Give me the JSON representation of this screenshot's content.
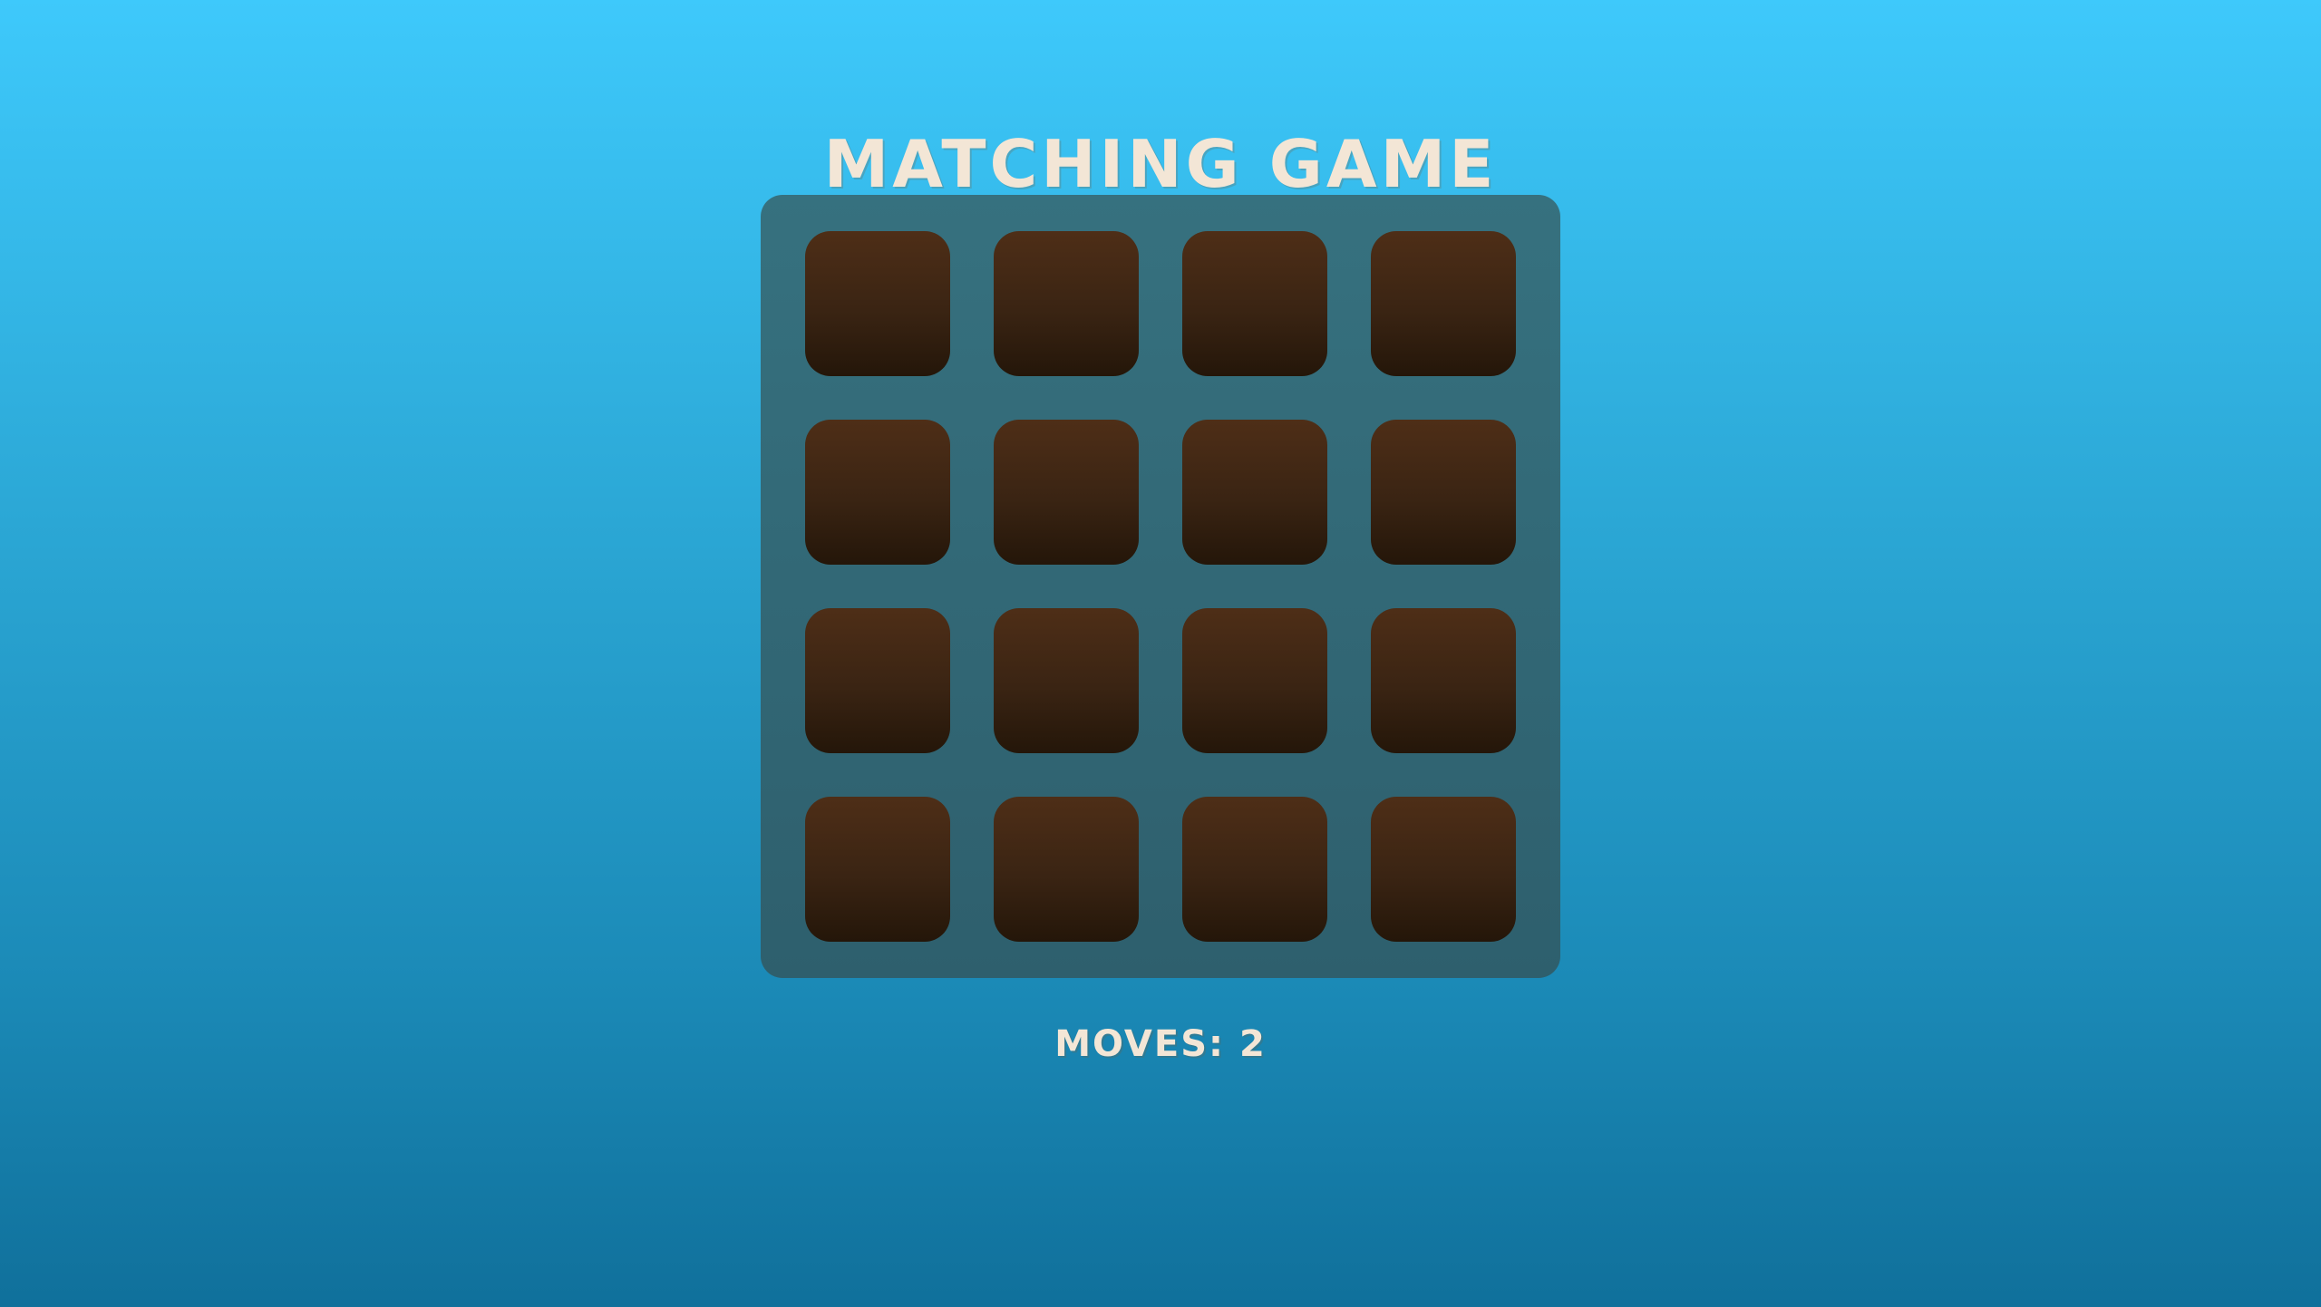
{
  "game": {
    "title": "MATCHING GAME",
    "moves_label": "MOVES:",
    "moves_value": "2",
    "grid": {
      "rows": 4,
      "columns": 4
    },
    "cards": [
      {
        "state": "face-down"
      },
      {
        "state": "face-down"
      },
      {
        "state": "face-down"
      },
      {
        "state": "face-down"
      },
      {
        "state": "face-down"
      },
      {
        "state": "face-down"
      },
      {
        "state": "face-down"
      },
      {
        "state": "face-down"
      },
      {
        "state": "face-down"
      },
      {
        "state": "face-down"
      },
      {
        "state": "face-down"
      },
      {
        "state": "face-down"
      },
      {
        "state": "face-down"
      },
      {
        "state": "face-down"
      },
      {
        "state": "face-down"
      },
      {
        "state": "face-down"
      }
    ]
  },
  "colors": {
    "background_top": "#3ec9fb",
    "background_bottom": "#10709b",
    "board": "#33697a",
    "card_back_top": "#4e2e17",
    "card_back_bottom": "#241609",
    "text": "#f3e6d6"
  }
}
